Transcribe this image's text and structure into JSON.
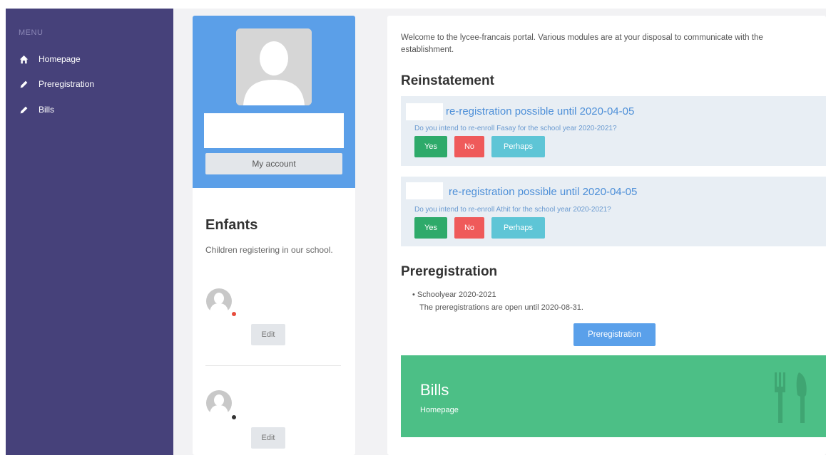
{
  "sidebar": {
    "menu_title": "MENU",
    "items": [
      {
        "label": "Homepage",
        "icon": "home-icon"
      },
      {
        "label": "Preregistration",
        "icon": "pencil-icon"
      },
      {
        "label": "Bills",
        "icon": "pencil-icon"
      }
    ]
  },
  "profile": {
    "account_button": "My account"
  },
  "children": {
    "title": "Enfants",
    "description": "Children registering in our school.",
    "items": [
      {
        "edit_label": "Edit",
        "status_color": "#e74c3c"
      },
      {
        "edit_label": "Edit",
        "status_color": "#333333"
      }
    ]
  },
  "main": {
    "welcome": "Welcome to the lycee-francais portal. Various modules are at your disposal to communicate with the establishment.",
    "reinstatement": {
      "title": "Reinstatement",
      "items": [
        {
          "headline": "re-registration possible until 2020-04-05",
          "question": "Do you intend to re-enroll Fasay for the school year 2020-2021?",
          "yes": "Yes",
          "no": "No",
          "perhaps": "Perhaps"
        },
        {
          "headline": "re-registration possible until 2020-04-05",
          "question": "Do you intend to re-enroll Athit for the school year 2020-2021?",
          "yes": "Yes",
          "no": "No",
          "perhaps": "Perhaps"
        }
      ]
    },
    "preregistration": {
      "title": "Preregistration",
      "year": "Schoolyear 2020-2021",
      "note": "The preregistrations are open until 2020-08-31.",
      "button": "Preregistration"
    },
    "bills": {
      "title": "Bills",
      "subtitle": "Homepage",
      "icon": "cutlery-icon"
    }
  },
  "colors": {
    "sidebar": "#46417a",
    "profile_header": "#5b9fe8",
    "yes": "#2eaa6a",
    "no": "#ef5a5a",
    "perhaps": "#5ec5d6",
    "bills": "#4cbf86"
  }
}
